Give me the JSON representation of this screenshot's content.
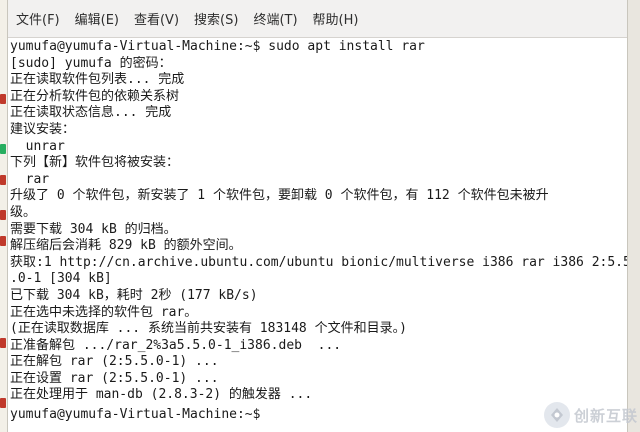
{
  "menu": {
    "items": [
      {
        "label": "文件(F)"
      },
      {
        "label": "编辑(E)"
      },
      {
        "label": "查看(V)"
      },
      {
        "label": "搜索(S)"
      },
      {
        "label": "终端(T)"
      },
      {
        "label": "帮助(H)"
      }
    ]
  },
  "terminal": {
    "lines": [
      "yumufa@yumufa-Virtual-Machine:~$ sudo apt install rar",
      "[sudo] yumufa 的密码：",
      "正在读取软件包列表... 完成",
      "正在分析软件包的依赖关系树",
      "正在读取状态信息... 完成",
      "建议安装：",
      "  unrar",
      "下列【新】软件包将被安装：",
      "  rar",
      "升级了 0 个软件包，新安装了 1 个软件包，要卸载 0 个软件包，有 112 个软件包未被升",
      "级。",
      "需要下载 304 kB 的归档。",
      "解压缩后会消耗 829 kB 的额外空间。",
      "获取:1 http://cn.archive.ubuntu.com/ubuntu bionic/multiverse i386 rar i386 2:5.5",
      ".0-1 [304 kB]",
      "已下载 304 kB，耗时 2秒 (177 kB/s)",
      "正在选中未选择的软件包 rar。",
      "(正在读取数据库 ... 系统当前共安装有 183148 个文件和目录。)",
      "正准备解包 .../rar_2%3a5.5.0-1_i386.deb  ...",
      "正在解包 rar (2:5.5.0-1) ...",
      "正在设置 rar (2:5.5.0-1) ...",
      "正在处理用于 man-db (2.8.3-2) 的触发器 ...",
      "yumufa@yumufa-Virtual-Machine:~$ "
    ]
  },
  "watermark": {
    "text": "创新互联"
  },
  "colors": {
    "menubar_bg": "#f2f1f0",
    "terminal_bg": "#ffffff",
    "terminal_fg": "#1a1a1a"
  }
}
